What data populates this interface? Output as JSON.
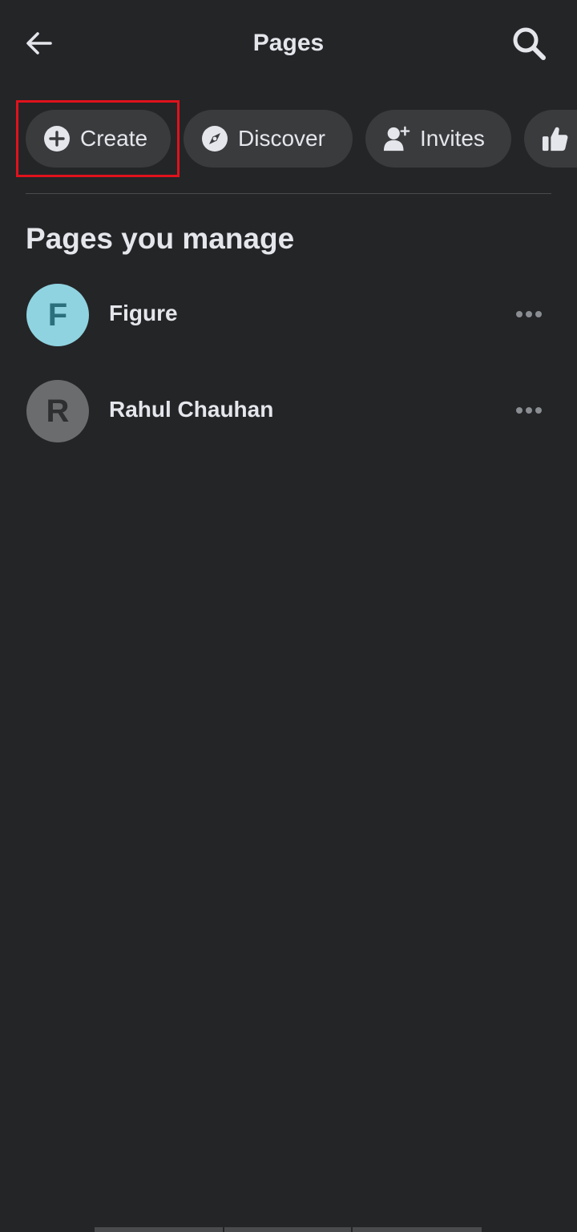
{
  "header": {
    "title": "Pages",
    "back_icon": "arrow-left-icon",
    "search_icon": "search-icon"
  },
  "chips": [
    {
      "label": "Create",
      "icon": "plus-circle-icon"
    },
    {
      "label": "Discover",
      "icon": "compass-icon"
    },
    {
      "label": "Invites",
      "icon": "person-add-icon"
    },
    {
      "label": "",
      "icon": "thumbs-up-icon"
    }
  ],
  "section": {
    "title": "Pages you manage"
  },
  "pages": [
    {
      "initial": "F",
      "name": "Figure",
      "avatar_color": "#8fd3e0"
    },
    {
      "initial": "R",
      "name": "Rahul Chauhan",
      "avatar_color": "#6b6c6e"
    }
  ],
  "colors": {
    "background": "#242527",
    "chip_background": "#3a3b3d",
    "highlight": "#e0121c",
    "text": "#e4e6eb"
  }
}
